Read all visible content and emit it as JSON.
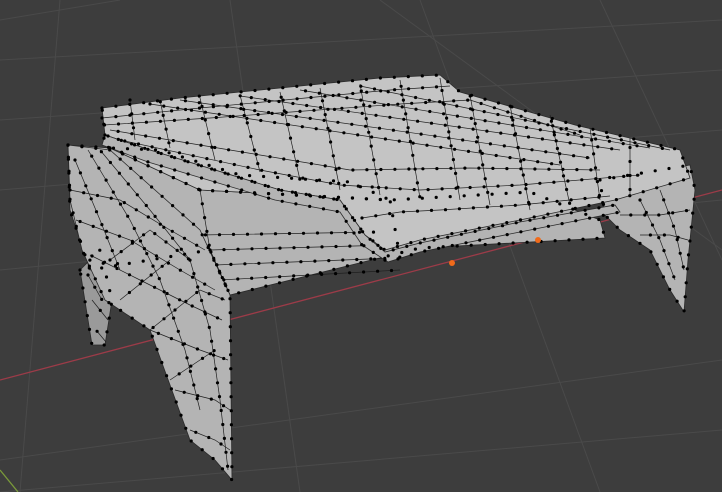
{
  "viewport": {
    "background_color": "#3d3d3d",
    "grid_color": "#4a4a4a",
    "x_axis_color": "#9c3b48",
    "y_axis_color": "#7a9a3a",
    "mesh_color": "#b4b4b4",
    "vertex_color": "#000000",
    "selected_vertex_color": "#f06a1a",
    "display_mode": "edit-mode-vertex",
    "selected_vertex_count": 2
  },
  "mesh": {
    "icon": "mesh-object-icon",
    "parts": [
      "table-top-slab",
      "lower-slab",
      "front-left-leg",
      "front-right-leg",
      "back-left-leg"
    ]
  }
}
